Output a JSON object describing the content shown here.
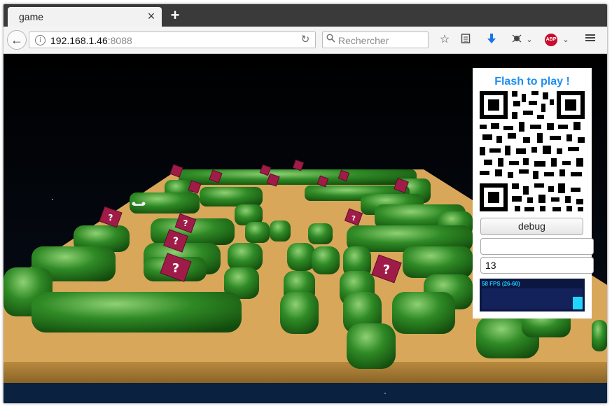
{
  "browser": {
    "tab_title": "game",
    "tab_close": "×",
    "new_tab": "+",
    "url_host": "192.168.1.46",
    "url_port": ":8088",
    "search_placeholder": "Rechercher"
  },
  "game_panel": {
    "flash_label": "Flash to play !",
    "debug_button": "debug",
    "text_input_value": "",
    "number_input_value": "13",
    "fps_readout": "58 FPS (26-60)"
  },
  "colors": {
    "flash_text": "#1f8ff0",
    "sand": "#d9a75a",
    "hedge": "#2f8a25",
    "block": "#a01c48",
    "sky": "#000000"
  }
}
